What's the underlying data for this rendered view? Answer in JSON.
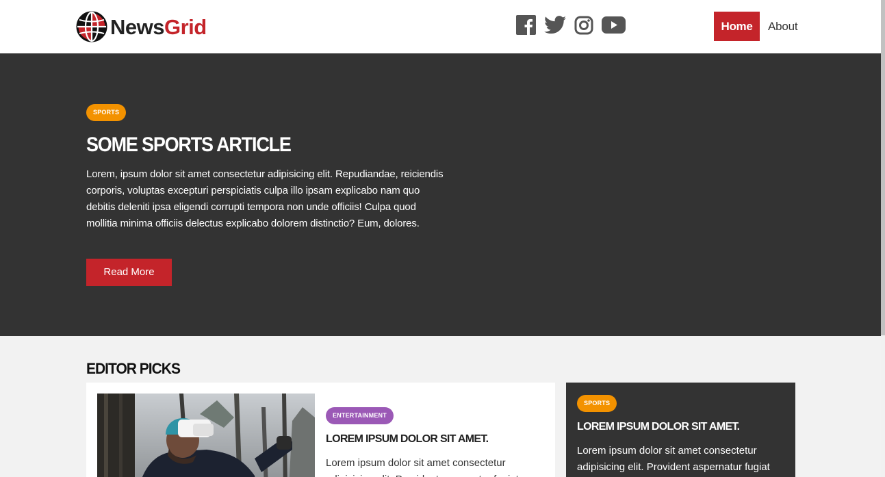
{
  "brand": {
    "name_part1": "News",
    "name_part2": "Grid"
  },
  "social": [
    {
      "icon": "facebook-icon",
      "label": "Facebook"
    },
    {
      "icon": "twitter-icon",
      "label": "Twitter"
    },
    {
      "icon": "instagram-icon",
      "label": "Instagram"
    },
    {
      "icon": "youtube-icon",
      "label": "YouTube"
    }
  ],
  "nav": {
    "home": "Home",
    "about": "About"
  },
  "hero": {
    "tag": "Sports",
    "title": "Some Sports Article",
    "body": "Lorem, ipsum dolor sit amet consectetur adipisicing elit. Repudiandae, reiciendis corporis, voluptas excepturi perspiciatis culpa illo ipsam explicabo nam quo debitis deleniti ipsa eligendi corrupti tempora non unde officiis! Culpa quod mollitia minima officiis delectus explicabo dolorem distinctio? Eum, dolores.",
    "button": "Read More"
  },
  "picks": {
    "title": "Editor Picks",
    "main": {
      "tag": "Entertainment",
      "title": "Lorem ipsum dolor sit amet.",
      "body": "Lorem ipsum dolor sit amet consectetur adipisicing elit. Provident aspernatur fugiat"
    },
    "side": {
      "tag": "Sports",
      "title": "Lorem ipsum dolor sit amet.",
      "body": "Lorem ipsum dolor sit amet consectetur adipisicing elit. Provident aspernatur fugiat"
    }
  },
  "colors": {
    "accent": "#c4242a",
    "sports": "#f39200",
    "entertainment": "#9b59b6",
    "dark": "#333333"
  }
}
